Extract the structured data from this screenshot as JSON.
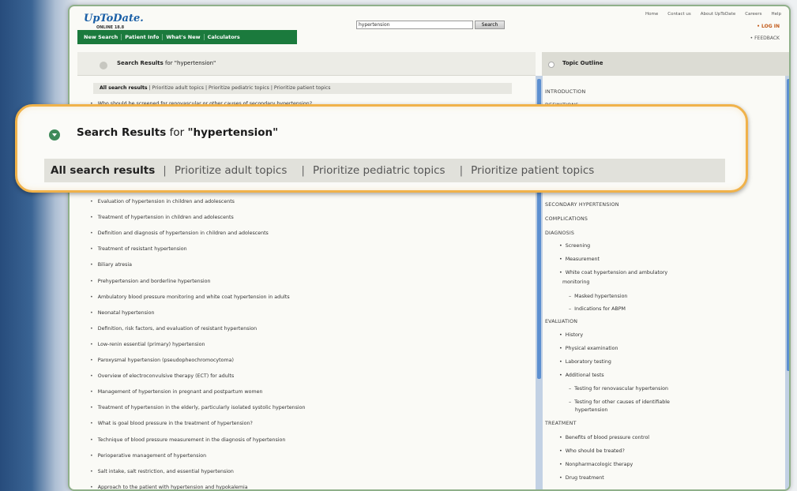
{
  "header": {
    "logo_name": "UpToDate.",
    "logo_sub": "ONLINE 18.8",
    "nav": [
      "New Search",
      "Patient Info",
      "What's New",
      "Calculators"
    ],
    "search_value": "hypertension",
    "search_button": "Search",
    "toplinks": [
      "Home",
      "Contact us",
      "About UpToDate",
      "Careers",
      "Help"
    ],
    "login": "LOG IN",
    "feedback": "FEEDBACK"
  },
  "results": {
    "title_bold": "Search Results",
    "title_rest": " for \"hypertension\"",
    "filters": [
      "All search results",
      "Prioritize adult topics",
      "Prioritize pediatric topics",
      "Prioritize patient topics"
    ],
    "items": [
      "Who should be screened for renovascular or other causes of secondary hypertension?",
      "Evaluation of hypertension in children and adolescents",
      "Treatment of hypertension in children and adolescents",
      "Definition and diagnosis of hypertension in children and adolescents",
      "Treatment of resistant hypertension",
      "Biliary atresia",
      "Prehypertension and borderline hypertension",
      "Ambulatory blood pressure monitoring and white coat hypertension in adults",
      "Neonatal hypertension",
      "Definition, risk factors, and evaluation of resistant hypertension",
      "Low-renin essential (primary) hypertension",
      "Paroxysmal hypertension (pseudopheochromocytoma)",
      "Overview of electroconvulsive therapy (ECT) for adults",
      "Management of hypertension in pregnant and postpartum women",
      "Treatment of hypertension in the elderly, particularly isolated systolic hypertension",
      "What is goal blood pressure in the treatment of hypertension?",
      "Technique of blood pressure measurement in the diagnosis of hypertension",
      "Perioperative management of hypertension",
      "Salt intake, salt restriction, and essential hypertension",
      "Approach to the patient with hypertension and hypokalemia"
    ]
  },
  "outline": {
    "title": "Topic Outline",
    "items": [
      {
        "text": "INTRODUCTION",
        "level": "sec"
      },
      {
        "text": "DEFINITIONS",
        "level": "sec"
      },
      {
        "text": "SECONDARY HYPERTENSION",
        "level": "sec"
      },
      {
        "text": "COMPLICATIONS",
        "level": "sec"
      },
      {
        "text": "DIAGNOSIS",
        "level": "sec"
      },
      {
        "text": "Screening",
        "level": "sub"
      },
      {
        "text": "Measurement",
        "level": "sub"
      },
      {
        "text": "White coat hypertension and ambulatory",
        "level": "sub"
      },
      {
        "text": "monitoring",
        "level": "cont"
      },
      {
        "text": "Masked hypertension",
        "level": "subsub"
      },
      {
        "text": "Indications for ABPM",
        "level": "subsub"
      },
      {
        "text": "EVALUATION",
        "level": "sec"
      },
      {
        "text": "History",
        "level": "sub"
      },
      {
        "text": "Physical examination",
        "level": "sub"
      },
      {
        "text": "Laboratory testing",
        "level": "sub"
      },
      {
        "text": "Additional tests",
        "level": "sub"
      },
      {
        "text": "Testing for renovascular hypertension",
        "level": "subsub"
      },
      {
        "text": "Testing for other causes of identifiable",
        "level": "subsub"
      },
      {
        "text": "hypertension",
        "level": "cont2"
      },
      {
        "text": "TREATMENT",
        "level": "sec"
      },
      {
        "text": "Benefits of blood pressure control",
        "level": "sub"
      },
      {
        "text": "Who should be treated?",
        "level": "sub"
      },
      {
        "text": "Nonpharmacologic therapy",
        "level": "sub"
      },
      {
        "text": "Drug treatment",
        "level": "sub"
      }
    ]
  },
  "callout": {
    "title_bold": "Search Results",
    "title_rest": " for ",
    "title_query": "\"hypertension\"",
    "tabs": [
      "All search results",
      "Prioritize adult topics",
      "Prioritize pediatric topics",
      "Prioritize patient topics"
    ]
  },
  "colors": {
    "nav_green": "#1b7a3d",
    "accent_orange": "#f0b24a",
    "scroll_blue": "#5c8fd0"
  }
}
